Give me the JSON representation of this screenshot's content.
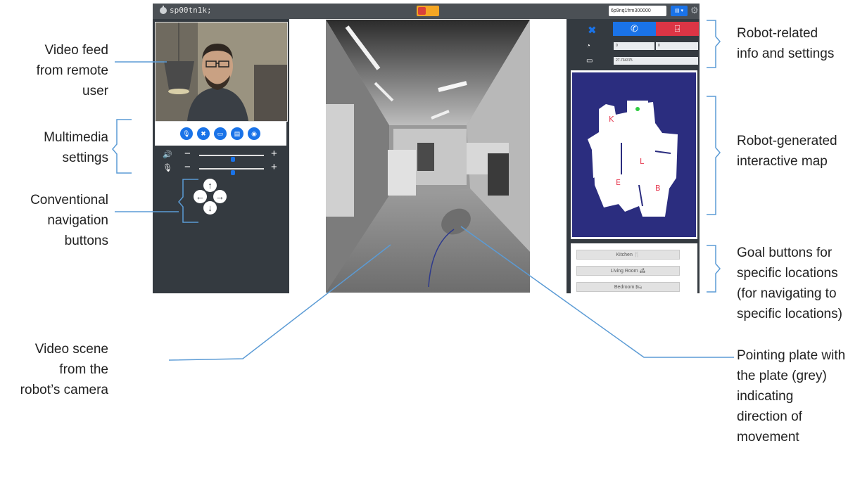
{
  "app": {
    "title": "sp00tn1k;",
    "robot_id": "6p9nq1frm300000",
    "dropdown": "▤ ▾",
    "gear_icon": "gear-icon",
    "logo_icon": "robot-logo-icon"
  },
  "multimedia": {
    "buttons": [
      {
        "icon": "mic-off-icon",
        "glyph": "🎙"
      },
      {
        "icon": "camera-off-icon",
        "glyph": "✖"
      },
      {
        "icon": "screen-share-icon",
        "glyph": "▭"
      },
      {
        "icon": "file-icon",
        "glyph": "▤"
      },
      {
        "icon": "gamepad-icon",
        "glyph": "◉"
      }
    ],
    "volume": {
      "icon": "speaker-icon",
      "level": 0.52
    },
    "microphone": {
      "icon": "microphone-icon",
      "level": 0.52
    }
  },
  "navigation": {
    "up": "↑",
    "left": "←",
    "right": "→",
    "down": "↓"
  },
  "robot_info": {
    "speed_1": "0",
    "speed_2": "0",
    "battery": "27.734375",
    "speed_icon": "speedometer-icon",
    "battery_icon": "battery-icon"
  },
  "map_labels": {
    "k": "K",
    "l": "L",
    "e": "E",
    "b": "B"
  },
  "goals": [
    {
      "label": "Kitchen 🍴"
    },
    {
      "label": "Living Room 🛋"
    },
    {
      "label": "Bedroom 🛏"
    }
  ],
  "annotations": {
    "video_feed": [
      "Video feed",
      "from remote",
      "user"
    ],
    "multimedia": [
      "Multimedia",
      "settings"
    ],
    "navigation": [
      "Conventional",
      "navigation",
      "buttons"
    ],
    "video_scene": [
      "Video scene",
      "from the",
      "robot’s camera"
    ],
    "robot_info": [
      "Robot-related",
      "info and settings"
    ],
    "map": [
      "Robot-generated",
      "interactive map"
    ],
    "goals": [
      "Goal buttons for",
      "specific locations",
      "(for navigating to",
      "specific locations)"
    ],
    "pointing": [
      "Pointing plate with",
      "the plate (grey)",
      "indicating",
      "direction of",
      "movement"
    ]
  },
  "colors": {
    "primary": "#1a73e8",
    "danger": "#dc3545",
    "panel": "#343a40",
    "map": "#2b2d7f",
    "callout": "#5b9bd5"
  }
}
